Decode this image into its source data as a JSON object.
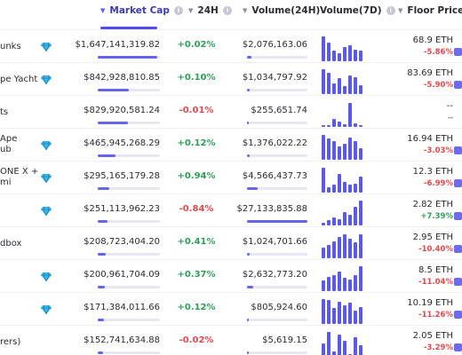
{
  "header": {
    "market_cap": "Market Cap",
    "change_24h": "24H",
    "volume_24h": "Volume(24H)",
    "volume_7d": "Volume(7D)",
    "floor_price": "Floor Price"
  },
  "rows": [
    {
      "name": "unks",
      "diamond": true,
      "market_cap": "$1,647,141,319.82",
      "mcap_fill": 0.95,
      "change": "+0.02%",
      "change_dir": "pos",
      "volume": "$2,076,163.06",
      "vol_fill": 0.08,
      "spark": [
        0.95,
        0.7,
        0.4,
        0.3,
        0.55,
        0.6,
        0.45,
        0.4
      ],
      "floor": "68.9 ETH",
      "floor_change": "-5.86%",
      "floor_dir": "neg",
      "trend_icon": true
    },
    {
      "name": "pe Yacht",
      "diamond": true,
      "market_cap": "$842,928,810.85",
      "mcap_fill": 0.5,
      "change": "+0.10%",
      "change_dir": "pos",
      "volume": "$1,034,797.92",
      "vol_fill": 0.04,
      "spark": [
        0.95,
        0.8,
        0.4,
        0.6,
        0.3,
        0.7,
        0.65,
        0.35
      ],
      "floor": "83.69 ETH",
      "floor_change": "-5.90%",
      "floor_dir": "neg",
      "trend_icon": true
    },
    {
      "name": "ts",
      "diamond": false,
      "market_cap": "$829,920,581.24",
      "mcap_fill": 0.49,
      "change": "-0.01%",
      "change_dir": "neg",
      "volume": "$255,651.74",
      "vol_fill": 0.01,
      "spark": [
        0.05,
        0.05,
        0.3,
        0.2,
        0.1,
        0.9,
        0.15,
        0.05
      ],
      "floor": "--",
      "floor_change": "--",
      "floor_dir": "neutral",
      "trend_icon": false
    },
    {
      "name": "Ape\nub",
      "diamond": true,
      "market_cap": "$465,945,268.29",
      "mcap_fill": 0.28,
      "change": "+0.12%",
      "change_dir": "pos",
      "volume": "$1,376,022.22",
      "vol_fill": 0.05,
      "spark": [
        0.95,
        0.8,
        0.7,
        0.5,
        0.6,
        0.85,
        0.7,
        0.45
      ],
      "floor": "16.94 ETH",
      "floor_change": "-3.03%",
      "floor_dir": "neg",
      "trend_icon": true
    },
    {
      "name": "ONE X +\nmi",
      "diamond": true,
      "market_cap": "$295,165,179.28",
      "mcap_fill": 0.18,
      "change": "+0.94%",
      "change_dir": "pos",
      "volume": "$4,566,437.73",
      "vol_fill": 0.17,
      "spark": [
        0.95,
        0.2,
        0.3,
        0.7,
        0.4,
        0.3,
        0.35,
        0.6
      ],
      "floor": "12.3 ETH",
      "floor_change": "-6.99%",
      "floor_dir": "neg",
      "trend_icon": true
    },
    {
      "name": "",
      "diamond": true,
      "market_cap": "$251,113,962.23",
      "mcap_fill": 0.15,
      "change": "-0.84%",
      "change_dir": "neg",
      "volume": "$27,133,835.88",
      "vol_fill": 1.0,
      "spark": [
        0.1,
        0.2,
        0.3,
        0.25,
        0.5,
        0.4,
        0.7,
        0.95
      ],
      "floor": "2.82 ETH",
      "floor_change": "+7.39%",
      "floor_dir": "pos",
      "trend_icon": true
    },
    {
      "name": "dbox",
      "diamond": false,
      "market_cap": "$208,723,404.20",
      "mcap_fill": 0.13,
      "change": "+0.41%",
      "change_dir": "pos",
      "volume": "$1,024,701.66",
      "vol_fill": 0.04,
      "spark": [
        0.4,
        0.5,
        0.65,
        0.8,
        0.9,
        0.75,
        0.6,
        0.9
      ],
      "floor": "2.95 ETH",
      "floor_change": "-10.40%",
      "floor_dir": "neg",
      "trend_icon": true
    },
    {
      "name": "",
      "diamond": true,
      "market_cap": "$200,961,704.09",
      "mcap_fill": 0.12,
      "change": "+0.37%",
      "change_dir": "pos",
      "volume": "$2,632,773.20",
      "vol_fill": 0.1,
      "spark": [
        0.4,
        0.55,
        0.6,
        0.75,
        0.5,
        0.45,
        0.6,
        0.95
      ],
      "floor": "8.5 ETH",
      "floor_change": "-11.04%",
      "floor_dir": "neg",
      "trend_icon": true
    },
    {
      "name": "",
      "diamond": true,
      "market_cap": "$171,384,011.66",
      "mcap_fill": 0.1,
      "change": "+0.12%",
      "change_dir": "pos",
      "volume": "$805,924.60",
      "vol_fill": 0.03,
      "spark": [
        0.95,
        0.9,
        0.6,
        0.85,
        0.7,
        0.8,
        0.5,
        0.65
      ],
      "floor": "10.19 ETH",
      "floor_change": "-11.26%",
      "floor_dir": "neg",
      "trend_icon": true
    },
    {
      "name": "rers)",
      "diamond": false,
      "market_cap": "$152,741,634.88",
      "mcap_fill": 0.09,
      "change": "-0.02%",
      "change_dir": "neg",
      "volume": "$5,619.15",
      "vol_fill": 0.002,
      "spark": [
        0.5,
        0.95,
        0.2,
        0.85,
        0.6,
        0.1,
        0.75,
        0.45
      ],
      "floor": "2.05 ETH",
      "floor_change": "-3.29%",
      "floor_dir": "neg",
      "trend_icon": true
    }
  ]
}
